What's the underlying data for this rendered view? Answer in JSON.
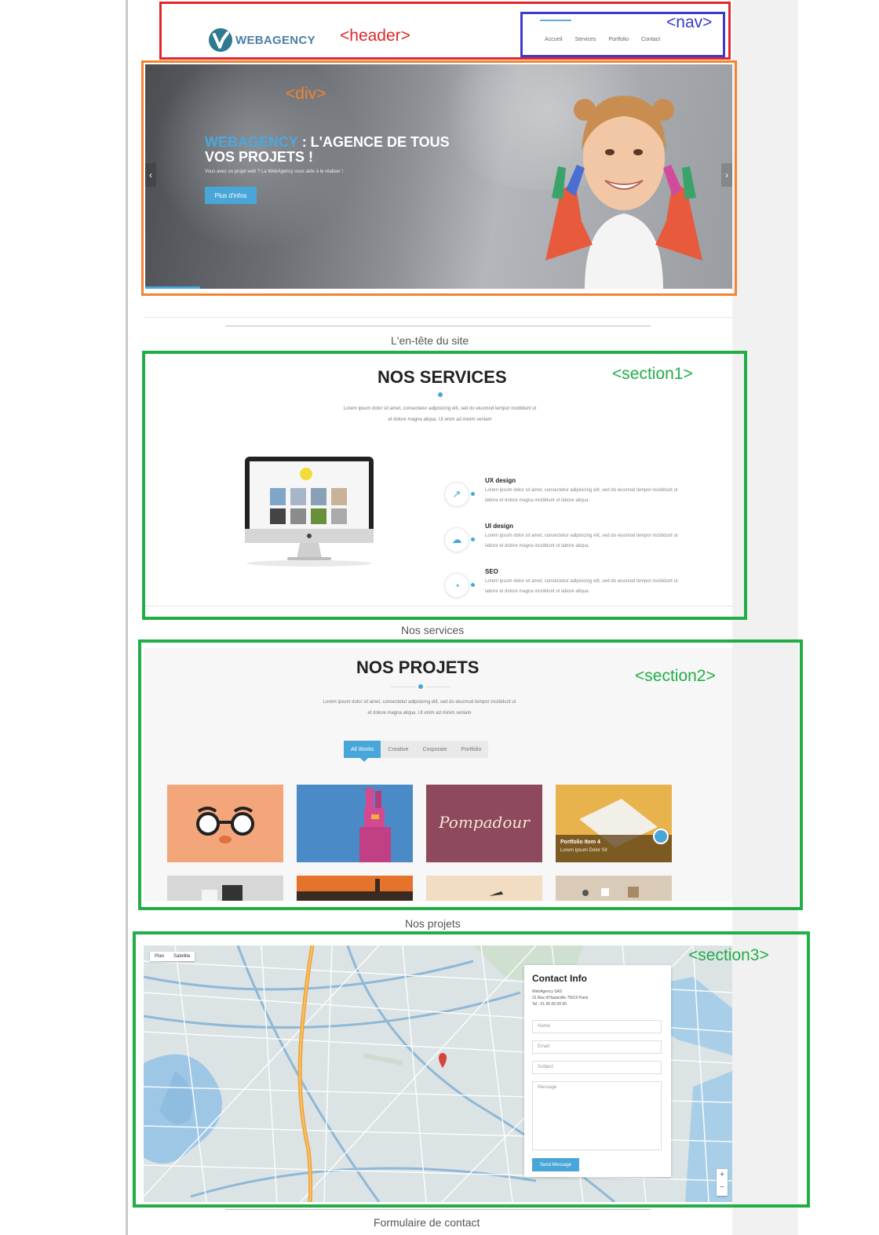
{
  "header": {
    "logo_text": "WEBAGENCY",
    "nav": [
      "Accueil",
      "Services",
      "Portfolio",
      "Contact"
    ]
  },
  "hero": {
    "title_accent": "WEBAGENCY",
    "title_rest": " : L'AGENCE DE TOUS VOS PROJETS !",
    "subtitle": "Vous avez un projet web ? La WebAgency vous aide à le réaliser !",
    "button": "Plus d'infos",
    "prev_arrow": "‹",
    "next_arrow": "›"
  },
  "captions": {
    "header": "L'en-tête du site",
    "services": "Nos services",
    "projects": "Nos projets",
    "contact": "Formulaire de contact"
  },
  "annotations": {
    "header": "<header>",
    "nav": "<nav>",
    "div": "<div>",
    "section1": "<section1>",
    "section2": "<section2>",
    "section3": "<section3>"
  },
  "services": {
    "title": "NOS SERVICES",
    "lorem_line1": "Lorem ipsum dolor sit amet, consectetur adipisicing elit, sed do eiusmod tempor incididunt ut",
    "lorem_line2": "et dolore magna aliqua. Ut enim ad minim veniam",
    "items": [
      {
        "name": "UX design",
        "icon": "chart-icon",
        "desc": "Lorem ipsum dolor sit amet, consectetur adipisicing elit, sed do eiusmod tempor incididunt ut labore et dolore magna incididunt ut labore aliqua."
      },
      {
        "name": "UI design",
        "icon": "cloud-icon",
        "desc": "Lorem ipsum dolor sit amet, consectetur adipisicing elit, sed do eiusmod tempor incididunt ut labore et dolore magna incididunt ut labore aliqua."
      },
      {
        "name": "SEO",
        "icon": "pie-icon",
        "desc": "Lorem ipsum dolor sit amet, consectetur adipisicing elit, sed do eiusmod tempor incididunt ut labore et dolore magna incididunt ut labore aliqua."
      }
    ]
  },
  "projects": {
    "title": "NOS PROJETS",
    "lorem_line1": "Lorem ipsum dolor sit amet, consectetur adipisicing elit, sed do eiusmod tempor incididunt ut",
    "lorem_line2": "et dolore magna aliqua. Ut enim ad minim veniam",
    "filters": [
      "All Works",
      "Creative",
      "Corporate",
      "Portfolio"
    ],
    "tile_pompadour": "Pompadour",
    "featured_title": "Portfolio Item 4",
    "featured_sub": "Lorem Ipsum Dolor Sit"
  },
  "contact": {
    "map_toggle": [
      "Plan",
      "Satellite"
    ],
    "title": "Contact Info",
    "company": "WebAgency SAS",
    "address": "31 Rue d'Hauteville 75010 Paris",
    "phone": "Tel : 01 00 00 00 00",
    "fields": [
      "Name",
      "Email",
      "Subject",
      "Message"
    ],
    "send": "Send Message",
    "zoom_in": "+",
    "zoom_out": "−"
  },
  "colors": {
    "accent": "#48a7d8",
    "annotation_red": "#e0262b",
    "annotation_blue": "#3b3bc7",
    "annotation_orange": "#f28430",
    "annotation_green": "#22ad47"
  }
}
